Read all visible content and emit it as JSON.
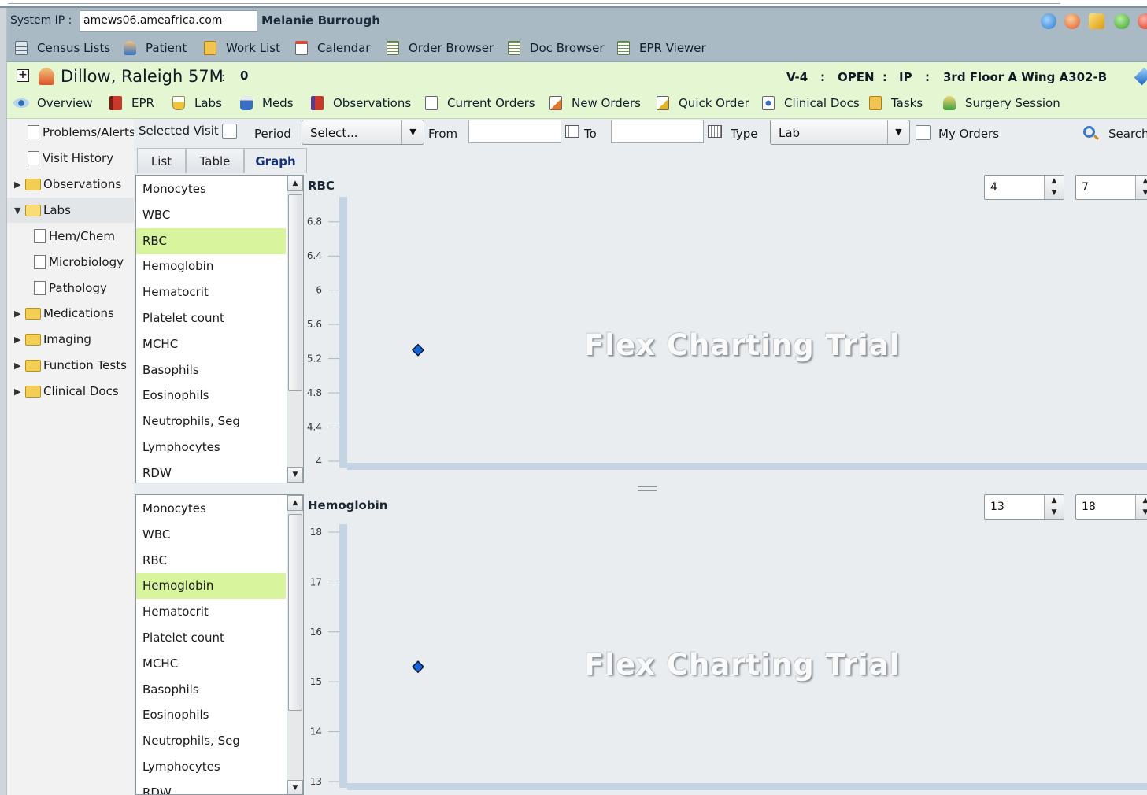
{
  "system": {
    "ip_label": "System IP :",
    "ip_value": "amews06.ameafrica.com",
    "user": "Melanie Burrough"
  },
  "nav": [
    {
      "label": "Census Lists",
      "icon": "grid-icon"
    },
    {
      "label": "Patient",
      "icon": "person-icon"
    },
    {
      "label": "Work List",
      "icon": "clipboard-icon"
    },
    {
      "label": "Calendar",
      "icon": "calendar-icon"
    },
    {
      "label": "Order Browser",
      "icon": "document-icon"
    },
    {
      "label": "Doc Browser",
      "icon": "document-icon"
    },
    {
      "label": "EPR Viewer",
      "icon": "document-icon"
    }
  ],
  "patient": {
    "name": "Dillow, Raleigh 57M",
    "sep": ":",
    "count": "0",
    "visit": "V-4",
    "status": "OPEN",
    "type": "IP",
    "location": "3rd Floor A Wing  A302-B",
    "colon": ":"
  },
  "modules": [
    {
      "label": "Overview",
      "icon": "eye-icon"
    },
    {
      "label": "EPR",
      "icon": "book-icon"
    },
    {
      "label": "Labs",
      "icon": "beaker-icon"
    },
    {
      "label": "Meds",
      "icon": "bottle-icon"
    },
    {
      "label": "Observations",
      "icon": "chart-book-icon"
    },
    {
      "label": "Current Orders",
      "icon": "document-icon"
    },
    {
      "label": "New Orders",
      "icon": "new-order-icon"
    },
    {
      "label": "Quick Order",
      "icon": "quick-order-icon"
    },
    {
      "label": "Clinical Docs",
      "icon": "clinical-doc-icon"
    },
    {
      "label": "Tasks",
      "icon": "clipboard-icon"
    },
    {
      "label": "Surgery Session",
      "icon": "surgeon-icon"
    }
  ],
  "tree": [
    {
      "label": "Problems/Alerts",
      "kind": "doc"
    },
    {
      "label": "Visit History",
      "kind": "doc"
    },
    {
      "label": "Observations",
      "kind": "folder"
    },
    {
      "label": "Labs",
      "kind": "folder-open"
    },
    {
      "label": "Hem/Chem",
      "kind": "doc"
    },
    {
      "label": "Microbiology",
      "kind": "doc"
    },
    {
      "label": "Pathology",
      "kind": "doc"
    },
    {
      "label": "Medications",
      "kind": "folder"
    },
    {
      "label": "Imaging",
      "kind": "folder"
    },
    {
      "label": "Function Tests",
      "kind": "folder"
    },
    {
      "label": "Clinical Docs",
      "kind": "folder"
    }
  ],
  "filters": {
    "selected_visit": "Selected Visit",
    "period": "Period",
    "period_value": "Select...",
    "from": "From",
    "to": "To",
    "type": "Type",
    "type_value": "Lab",
    "my_orders": "My Orders",
    "search": "Search"
  },
  "tabs": [
    "List",
    "Table",
    "Graph"
  ],
  "tests": [
    "Monocytes",
    "WBC",
    "RBC",
    "Hemoglobin",
    "Hematocrit",
    "Platelet count",
    "MCHC",
    "Basophils",
    "Eosinophils",
    "Neutrophils, Seg",
    "Lymphocytes",
    "RDW"
  ],
  "watermark": "Flex Charting Trial",
  "colors": {
    "selected": "#d8f59e",
    "marker": "#1565d8",
    "patient_bar": "#e5f7d2"
  },
  "chart_data": [
    {
      "type": "scatter",
      "title": "RBC",
      "selected": "RBC",
      "ylim": [
        4,
        7
      ],
      "min_value": "4",
      "max_value": "7",
      "yticks": [
        "6.8",
        "6.4",
        "6",
        "5.6",
        "5.2",
        "4.8",
        "4.4",
        "4"
      ],
      "points": [
        {
          "y": 5.3
        }
      ]
    },
    {
      "type": "scatter",
      "title": "Hemoglobin",
      "selected": "Hemoglobin",
      "ylim": [
        13,
        18
      ],
      "min_value": "13",
      "max_value": "18",
      "yticks": [
        "18",
        "17",
        "16",
        "15",
        "14",
        "13"
      ],
      "points": [
        {
          "y": 15.3
        }
      ]
    }
  ]
}
